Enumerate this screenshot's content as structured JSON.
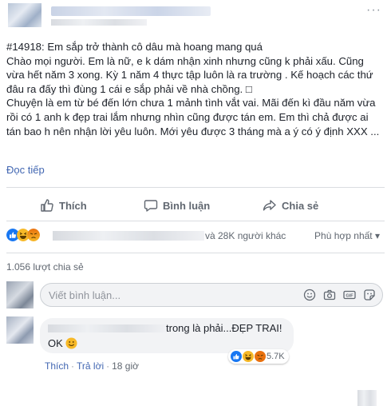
{
  "post": {
    "more_label": "···",
    "lines": [
      "#14918: Em sắp trở thành cô dâu mà hoang mang quá",
      "Chào mọi người. Em là nữ, e k dám nhận xinh nhưng cũng k phải xấu. Cũng vừa hết năm 3 xong. Kỳ 1 năm 4 thực tập luôn là ra trường . Kế hoạch các thứ đâu ra đấy thì đùng 1 cái e sắp phải về nhà chồng. □",
      "Chuyện là em từ bé đến lớn chưa 1 mảnh tình vắt vai. Mãi đến kì đầu năm vừa rồi có 1 anh k đẹp trai lắm nhưng nhìn cũng được tán em. Em thì chả được ai tán bao h nên nhận lời yêu luôn. Mới yêu được 3 tháng mà a ý có ý định XXX ..."
    ],
    "read_more": "Đọc tiếp"
  },
  "actions": {
    "like": "Thích",
    "comment": "Bình luận",
    "share": "Chia sẻ"
  },
  "reactions": {
    "summary": "và 28K người khác",
    "sort": "Phù hợp nhất ▾",
    "shares": "1.056 lượt chia sẻ"
  },
  "composer": {
    "placeholder": "Viết bình luận..."
  },
  "comment": {
    "text_line1": "trong là phải...ĐẸP TRAI!",
    "text_line2": "OK",
    "reaction_count": "5.7K",
    "like": "Thích",
    "reply": "Trả lời",
    "time": "18 giờ",
    "separator": "·"
  },
  "colors": {
    "link": "#4267b2",
    "like_blue": "#1877f2",
    "haha_yellow": "#f7b928",
    "angry": "#e9710f"
  }
}
